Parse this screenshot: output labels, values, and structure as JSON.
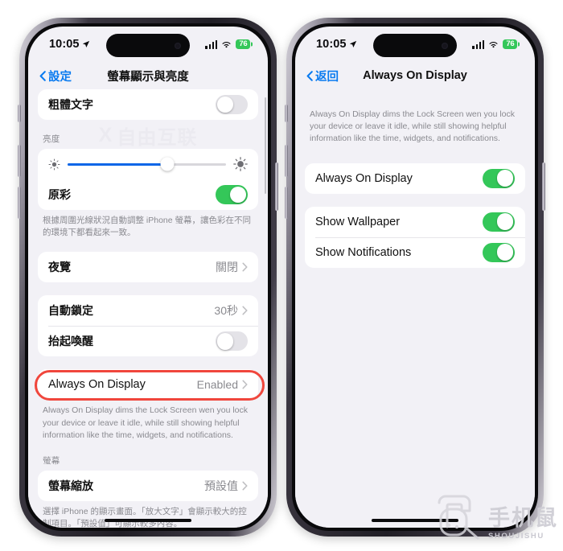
{
  "status_bar": {
    "time": "10:05",
    "location_icon": "location-arrow-icon",
    "signal_icon": "cellular-signal-icon",
    "wifi_icon": "wifi-icon",
    "battery_level": "76"
  },
  "left_phone": {
    "nav": {
      "back_label": "設定",
      "title": "螢幕顯示與亮度"
    },
    "rows": {
      "bold_text": "粗體文字",
      "bold_text_toggle": "off",
      "brightness_header": "亮度",
      "brightness_percent": 63,
      "true_tone": "原彩",
      "true_tone_toggle": "on",
      "true_tone_footnote": "根據周圍光線狀況自動調整 iPhone 螢幕，讓色彩在不同的環境下都看起來一致。",
      "night_shift_label": "夜覽",
      "night_shift_value": "關閉",
      "auto_lock_label": "自動鎖定",
      "auto_lock_value": "30秒",
      "raise_to_wake_label": "抬起喚醒",
      "raise_to_wake_toggle": "off",
      "aod_label": "Always On Display",
      "aod_value": "Enabled",
      "aod_footnote": "Always On Display dims the Lock Screen wen you lock your device or leave it idle, while still showing helpful information like the time, widgets, and notifications.",
      "display_section_header": "螢幕",
      "display_zoom_label": "螢幕縮放",
      "display_zoom_value": "預設值",
      "display_zoom_footnote": "選擇 iPhone 的顯示畫面。「放大文字」會顯示較大的控制項目。「預設值」可顯示較多內容。"
    },
    "highlight_color": "#f0463c"
  },
  "right_phone": {
    "nav": {
      "back_label": "返回",
      "title": "Always On Display"
    },
    "rows": {
      "intro_footnote": "Always On Display dims the Lock Screen wen you lock your device or leave it idle, while still showing helpful information like the time, widgets, and notifications.",
      "aod_label": "Always On Display",
      "aod_toggle": "on",
      "show_wallpaper_label": "Show Wallpaper",
      "show_wallpaper_toggle": "on",
      "show_notifications_label": "Show Notifications",
      "show_notifications_toggle": "on"
    }
  },
  "watermarks": {
    "center_logo": "X",
    "center_text": "自由互联",
    "corner_cn": "手机鼠",
    "corner_en": "SHOUJISHU"
  },
  "colors": {
    "accent_blue": "#0a7bf0",
    "toggle_green": "#34c759",
    "slider_blue": "#0a66e8",
    "highlight_red": "#f0463c"
  }
}
